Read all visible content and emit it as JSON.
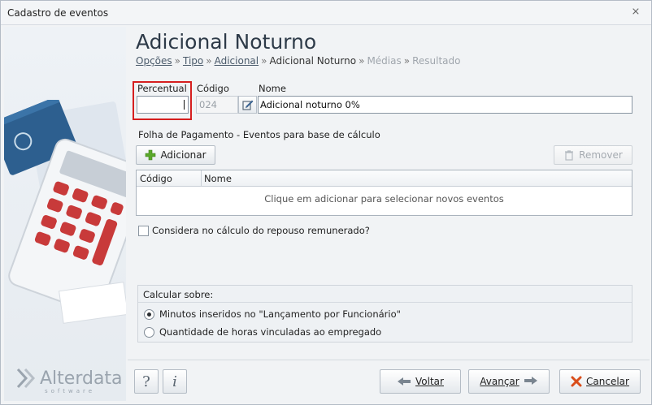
{
  "window": {
    "title": "Cadastro de eventos",
    "close_glyph": "⨯"
  },
  "sidebar": {
    "brand": "Alterdata",
    "brand_sub": "software"
  },
  "header": {
    "title": "Adicional Noturno",
    "breadcrumb": {
      "opcoes": "Opções",
      "tipo": "Tipo",
      "adicional": "Adicional",
      "current": "Adicional Noturno",
      "medias": "Médias",
      "resultado": "Resultado",
      "sep": "»"
    }
  },
  "form": {
    "percentual_label": "Percentual",
    "percentual_value": "",
    "codigo_label": "Código",
    "codigo_value": "024",
    "nome_label": "Nome",
    "nome_value": "Adicional noturno 0%"
  },
  "folha": {
    "title": "Folha de Pagamento - Eventos para base de cálculo",
    "add_label": "Adicionar",
    "remove_label": "Remover",
    "columns": [
      "Código",
      "Nome"
    ],
    "empty_message": "Clique em adicionar para selecionar novos eventos"
  },
  "options": {
    "repouso_label": "Considera no cálculo do repouso remunerado?",
    "repouso_checked": false
  },
  "calcular": {
    "title": "Calcular sobre:",
    "choices": [
      "Minutos inseridos no \"Lançamento por Funcionário\"",
      "Quantidade de horas vinculadas ao empregado"
    ],
    "selected_index": 0
  },
  "footer": {
    "help_glyph": "?",
    "info_glyph": "i",
    "voltar_label": "Voltar",
    "avancar_label": "Avançar",
    "cancelar_label": "Cancelar"
  },
  "colors": {
    "highlight": "#d61f1f",
    "add_icon": "#5aa82a",
    "cancel_icon": "#d94d1a",
    "arrow_icon": "#7a8590"
  }
}
